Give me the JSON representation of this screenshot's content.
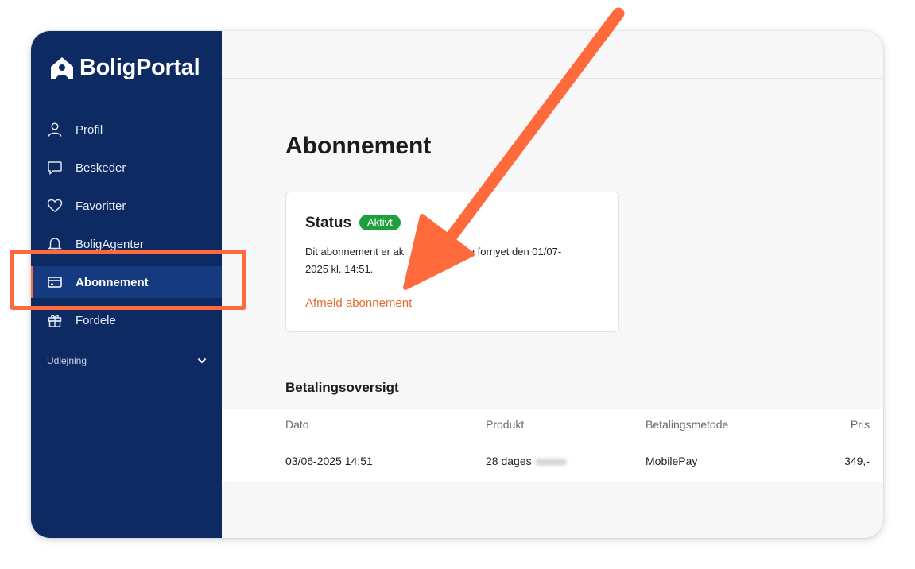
{
  "brand": {
    "name": "BoligPortal"
  },
  "sidebar": {
    "items": [
      {
        "label": "Profil",
        "icon": "user-icon"
      },
      {
        "label": "Beskeder",
        "icon": "chat-icon"
      },
      {
        "label": "Favoritter",
        "icon": "heart-icon"
      },
      {
        "label": "BoligAgenter",
        "icon": "bell-icon"
      },
      {
        "label": "Abonnement",
        "icon": "credit-card-icon",
        "active": true
      },
      {
        "label": "Fordele",
        "icon": "gift-icon"
      }
    ],
    "section": {
      "label": "Udlejning"
    }
  },
  "main": {
    "title": "Abonnement",
    "status_card": {
      "title": "Status",
      "badge": "Aktivt",
      "text": "Dit abonnement er ak… blive fornyet den 01/07-2025 kl. 14:51.",
      "text_line1": "Dit abonnement er ak",
      "text_line1b": "blive fornyet den 01/07-",
      "text_line2": "2025 kl. 14:51.",
      "link": "Afmeld abonnement"
    },
    "payments": {
      "title": "Betalingsoversigt",
      "headers": [
        "Dato",
        "Produkt",
        "Betalingsmetode",
        "Pris"
      ],
      "rows": [
        [
          "03/06-2025 14:51",
          "28 dages",
          "MobilePay",
          "349,-"
        ]
      ]
    }
  },
  "colors": {
    "sidebar_bg": "#0e2a63",
    "sidebar_active_bg": "#163a80",
    "accent_orange": "#ff6a3d",
    "badge_green": "#1f9e3d",
    "link_orange": "#ea6a2e"
  }
}
